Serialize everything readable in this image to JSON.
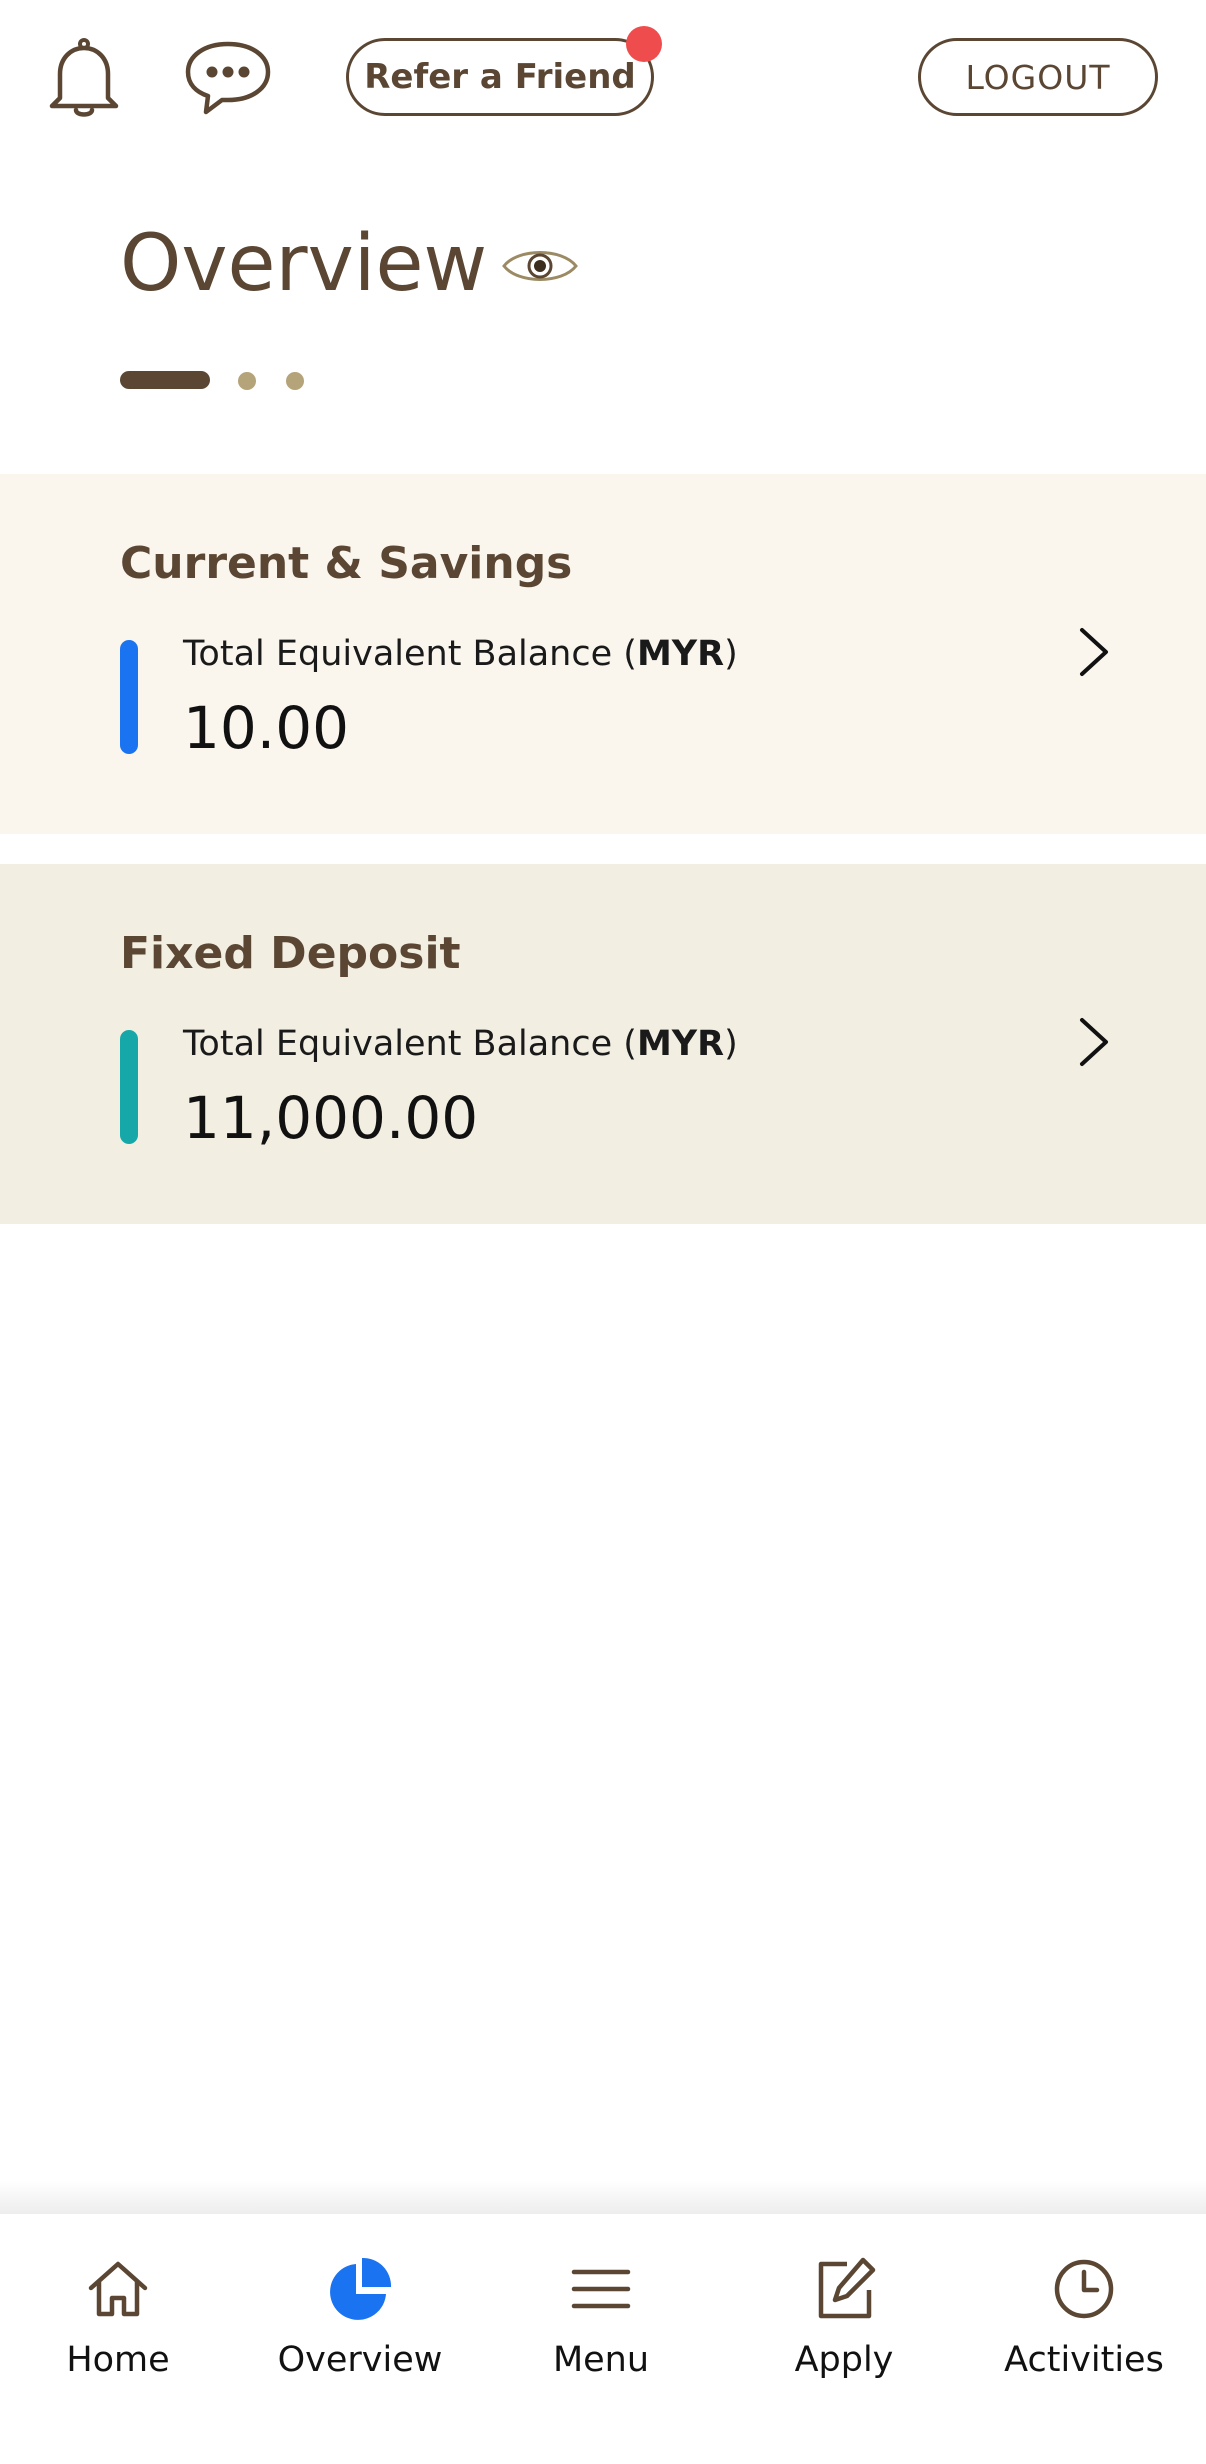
{
  "topbar": {
    "refer_label": "Refer a Friend",
    "logout_label": "LOGOUT",
    "notification_dot_color": "#ef4d4d"
  },
  "overview": {
    "title": "Overview",
    "pager": {
      "total": 3,
      "active_index": 0
    }
  },
  "cards": [
    {
      "title": "Current & Savings",
      "label_prefix": "Total Equivalent Balance (",
      "currency": "MYR",
      "label_suffix": ")",
      "amount": "10.00",
      "accent_color": "#1a73f0"
    },
    {
      "title": "Fixed Deposit",
      "label_prefix": "Total Equivalent Balance (",
      "currency": "MYR",
      "label_suffix": ")",
      "amount": "11,000.00",
      "accent_color": "#16a8a8"
    }
  ],
  "bottom_nav": {
    "items": [
      {
        "label": "Home",
        "icon": "home-icon"
      },
      {
        "label": "Overview",
        "icon": "pie-chart-icon",
        "active": true
      },
      {
        "label": "Menu",
        "icon": "hamburger-menu-icon"
      },
      {
        "label": "Apply",
        "icon": "edit-form-icon"
      },
      {
        "label": "Activities",
        "icon": "clock-icon"
      }
    ],
    "active_color": "#1a73f0"
  },
  "colors": {
    "brand_brown": "#5a4632",
    "card_savings_bg": "#faf6ee",
    "card_fixed_bg": "#f2efe2"
  }
}
